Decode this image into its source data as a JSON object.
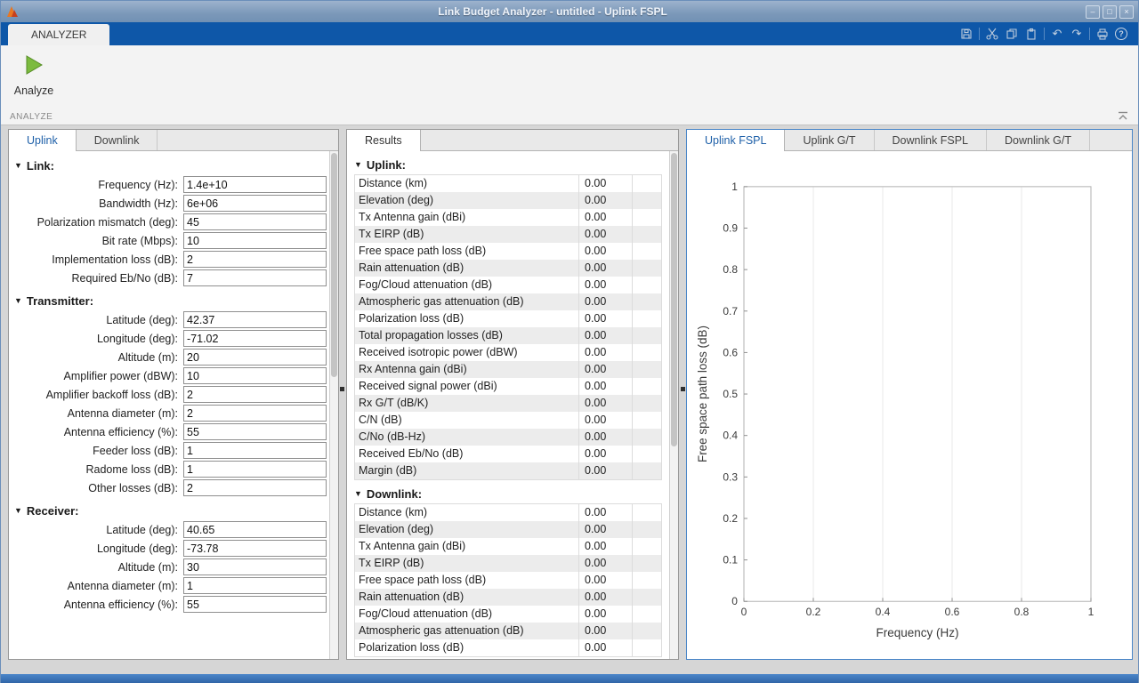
{
  "window": {
    "title": "Link Budget Analyzer - untitled - Uplink FSPL"
  },
  "toolstrip": {
    "tab_label": "ANALYZER",
    "analyze_label": "Analyze",
    "section_label": "ANALYZE",
    "quick_access": [
      "save-icon",
      "cut-icon",
      "copy-icon",
      "paste-icon",
      "undo-icon",
      "redo-icon",
      "print-icon",
      "help-icon"
    ]
  },
  "left_panel": {
    "tabs": [
      {
        "label": "Uplink",
        "selected": true
      },
      {
        "label": "Downlink",
        "selected": false
      }
    ],
    "sections": [
      {
        "title": "Link:",
        "fields": [
          {
            "label": "Frequency (Hz):",
            "value": "1.4e+10"
          },
          {
            "label": "Bandwidth (Hz):",
            "value": "6e+06"
          },
          {
            "label": "Polarization mismatch (deg):",
            "value": "45"
          },
          {
            "label": "Bit rate (Mbps):",
            "value": "10"
          },
          {
            "label": "Implementation loss (dB):",
            "value": "2"
          },
          {
            "label": "Required Eb/No (dB):",
            "value": "7"
          }
        ]
      },
      {
        "title": "Transmitter:",
        "fields": [
          {
            "label": "Latitude (deg):",
            "value": "42.37"
          },
          {
            "label": "Longitude (deg):",
            "value": "-71.02"
          },
          {
            "label": "Altitude (m):",
            "value": "20"
          },
          {
            "label": "Amplifier power (dBW):",
            "value": "10"
          },
          {
            "label": "Amplifier backoff loss (dB):",
            "value": "2"
          },
          {
            "label": "Antenna diameter (m):",
            "value": "2"
          },
          {
            "label": "Antenna efficiency (%):",
            "value": "55"
          },
          {
            "label": "Feeder loss (dB):",
            "value": "1"
          },
          {
            "label": "Radome loss (dB):",
            "value": "1"
          },
          {
            "label": "Other losses (dB):",
            "value": "2"
          }
        ]
      },
      {
        "title": "Receiver:",
        "fields": [
          {
            "label": "Latitude (deg):",
            "value": "40.65"
          },
          {
            "label": "Longitude (deg):",
            "value": "-73.78"
          },
          {
            "label": "Altitude (m):",
            "value": "30"
          },
          {
            "label": "Antenna diameter (m):",
            "value": "1"
          },
          {
            "label": "Antenna efficiency (%):",
            "value": "55"
          }
        ]
      }
    ]
  },
  "results_panel": {
    "tabs": [
      {
        "label": "Results",
        "selected": true
      }
    ],
    "sections": [
      {
        "title": "Uplink:",
        "rows": [
          [
            "Distance (km)",
            "0.00"
          ],
          [
            "Elevation (deg)",
            "0.00"
          ],
          [
            "Tx Antenna gain (dBi)",
            "0.00"
          ],
          [
            "Tx EIRP (dB)",
            "0.00"
          ],
          [
            "Free space path loss (dB)",
            "0.00"
          ],
          [
            "Rain attenuation (dB)",
            "0.00"
          ],
          [
            "Fog/Cloud attenuation (dB)",
            "0.00"
          ],
          [
            "Atmospheric gas attenuation (dB)",
            "0.00"
          ],
          [
            "Polarization loss (dB)",
            "0.00"
          ],
          [
            "Total propagation losses (dB)",
            "0.00"
          ],
          [
            "Received isotropic power (dBW)",
            "0.00"
          ],
          [
            "Rx Antenna gain (dBi)",
            "0.00"
          ],
          [
            "Received signal power (dBi)",
            "0.00"
          ],
          [
            "Rx G/T (dB/K)",
            "0.00"
          ],
          [
            "C/N (dB)",
            "0.00"
          ],
          [
            "C/No (dB-Hz)",
            "0.00"
          ],
          [
            "Received Eb/No (dB)",
            "0.00"
          ],
          [
            "Margin (dB)",
            "0.00"
          ]
        ]
      },
      {
        "title": "Downlink:",
        "rows": [
          [
            "Distance (km)",
            "0.00"
          ],
          [
            "Elevation (deg)",
            "0.00"
          ],
          [
            "Tx Antenna gain (dBi)",
            "0.00"
          ],
          [
            "Tx EIRP (dB)",
            "0.00"
          ],
          [
            "Free space path loss (dB)",
            "0.00"
          ],
          [
            "Rain attenuation (dB)",
            "0.00"
          ],
          [
            "Fog/Cloud attenuation (dB)",
            "0.00"
          ],
          [
            "Atmospheric gas attenuation (dB)",
            "0.00"
          ],
          [
            "Polarization loss (dB)",
            "0.00"
          ]
        ]
      }
    ]
  },
  "plot_panel": {
    "tabs": [
      {
        "label": "Uplink FSPL",
        "selected": true
      },
      {
        "label": "Uplink G/T",
        "selected": false
      },
      {
        "label": "Downlink FSPL",
        "selected": false
      },
      {
        "label": "Downlink G/T",
        "selected": false
      }
    ]
  },
  "chart_data": {
    "type": "line",
    "title": "",
    "xlabel": "Frequency (Hz)",
    "ylabel": "Free space path loss (dB)",
    "xlim": [
      0,
      1
    ],
    "ylim": [
      0,
      1
    ],
    "xticks": [
      "0",
      "0.2",
      "0.4",
      "0.6",
      "0.8",
      "1"
    ],
    "yticks": [
      "0",
      "0.1",
      "0.2",
      "0.3",
      "0.4",
      "0.5",
      "0.6",
      "0.7",
      "0.8",
      "0.9",
      "1"
    ],
    "series": [],
    "grid": "vertical-only",
    "legend": "none",
    "note": "empty axes, no data plotted"
  },
  "colors": {
    "titlebar": "#8aa3c2",
    "toolstrip_bar": "#0e57a8",
    "ribbon_bg": "#f3f3f3",
    "accent_blue": "#1d5fa8",
    "analyze_green": "#7cbb3f",
    "desktop_bg": "#d6d6d6",
    "focus_border": "#4a86c8",
    "row_stripe": "#ececec"
  }
}
